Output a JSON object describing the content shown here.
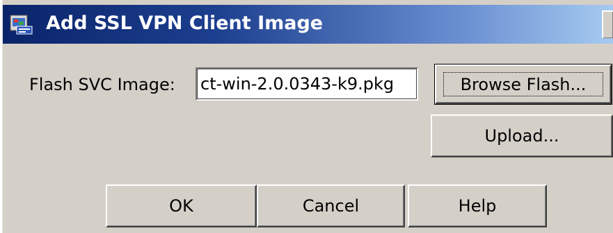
{
  "dialog": {
    "title": "Add SSL VPN Client Image",
    "icon": "add-image-icon"
  },
  "form": {
    "flash_label": "Flash SVC Image:",
    "flash_value": "ct-win-2.0.0343-k9.pkg"
  },
  "buttons": {
    "browse": "Browse Flash...",
    "upload": "Upload...",
    "ok": "OK",
    "cancel": "Cancel",
    "help": "Help"
  },
  "colors": {
    "titlebar_start": "#0a246a",
    "titlebar_end": "#a6caf0",
    "dialog_bg": "#d4d0c8"
  }
}
